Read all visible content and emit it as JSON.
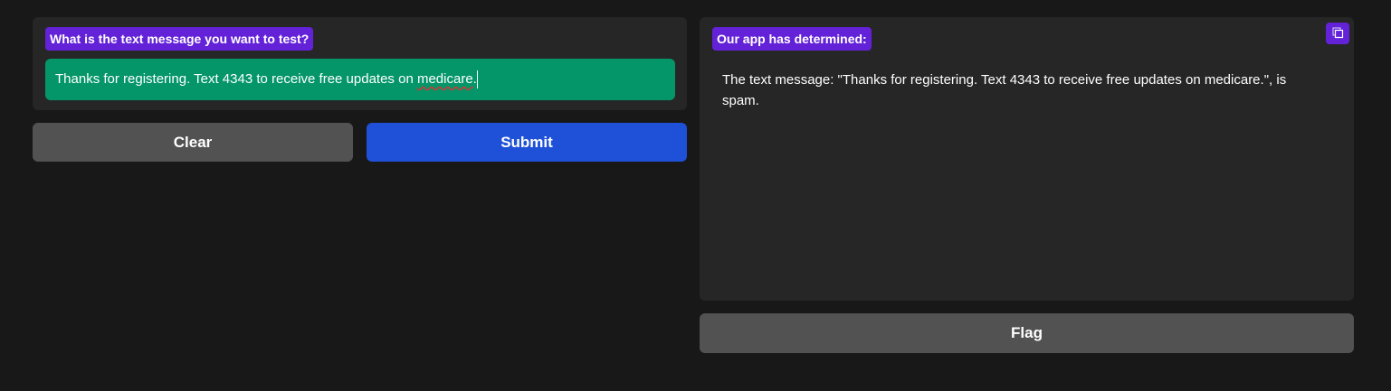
{
  "input_panel": {
    "label": "What is the text message you want to test?",
    "value_before": "Thanks for registering. Text 4343 to receive free updates on ",
    "value_misspelled": "medicare",
    "value_after": "."
  },
  "buttons": {
    "clear": "Clear",
    "submit": "Submit",
    "flag": "Flag"
  },
  "output_panel": {
    "label": "Our app has determined:",
    "text": "The text message: \"Thanks for registering. Text 4343 to receive free updates on medicare.\", is spam."
  },
  "colors": {
    "accent": "#6322d8",
    "input_bg": "#049669",
    "submit": "#1f51d8",
    "secondary": "#525252"
  }
}
